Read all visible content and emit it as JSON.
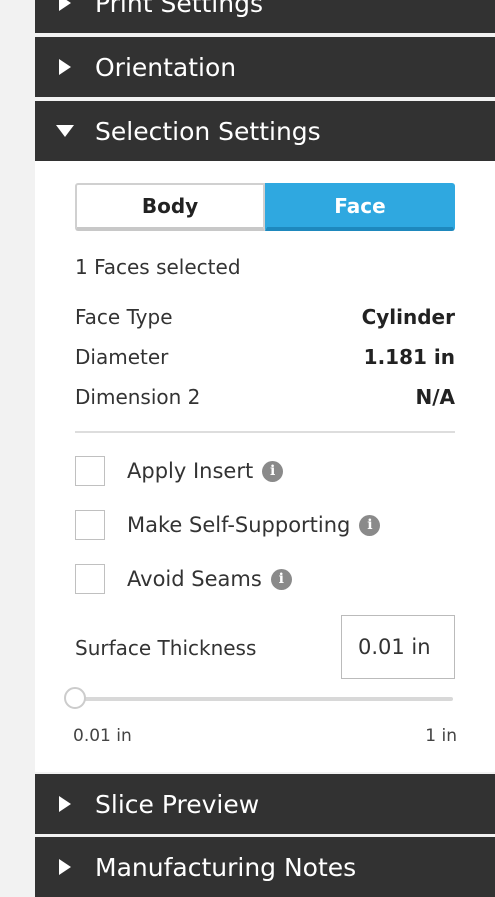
{
  "sections": {
    "print_settings": "Print Settings",
    "orientation": "Orientation",
    "selection_settings": "Selection Settings",
    "slice_preview": "Slice Preview",
    "manufacturing_notes": "Manufacturing Notes"
  },
  "selection": {
    "toggle": {
      "body_label": "Body",
      "face_label": "Face",
      "active": "Face"
    },
    "selected_count_text": "1 Faces selected",
    "properties": [
      {
        "label": "Face Type",
        "value": "Cylinder"
      },
      {
        "label": "Diameter",
        "value": "1.181 in"
      },
      {
        "label": "Dimension 2",
        "value": "N/A"
      }
    ],
    "checkboxes": [
      {
        "label": "Apply Insert",
        "checked": false
      },
      {
        "label": "Make Self-Supporting",
        "checked": false
      },
      {
        "label": "Avoid Seams",
        "checked": false
      }
    ],
    "surface_thickness": {
      "label": "Surface Thickness",
      "value": "0.01 in",
      "slider_min_label": "0.01 in",
      "slider_max_label": "1 in",
      "slider_fraction": 0.0
    }
  },
  "colors": {
    "header_bg": "#323232",
    "accent": "#2fa8e0"
  }
}
